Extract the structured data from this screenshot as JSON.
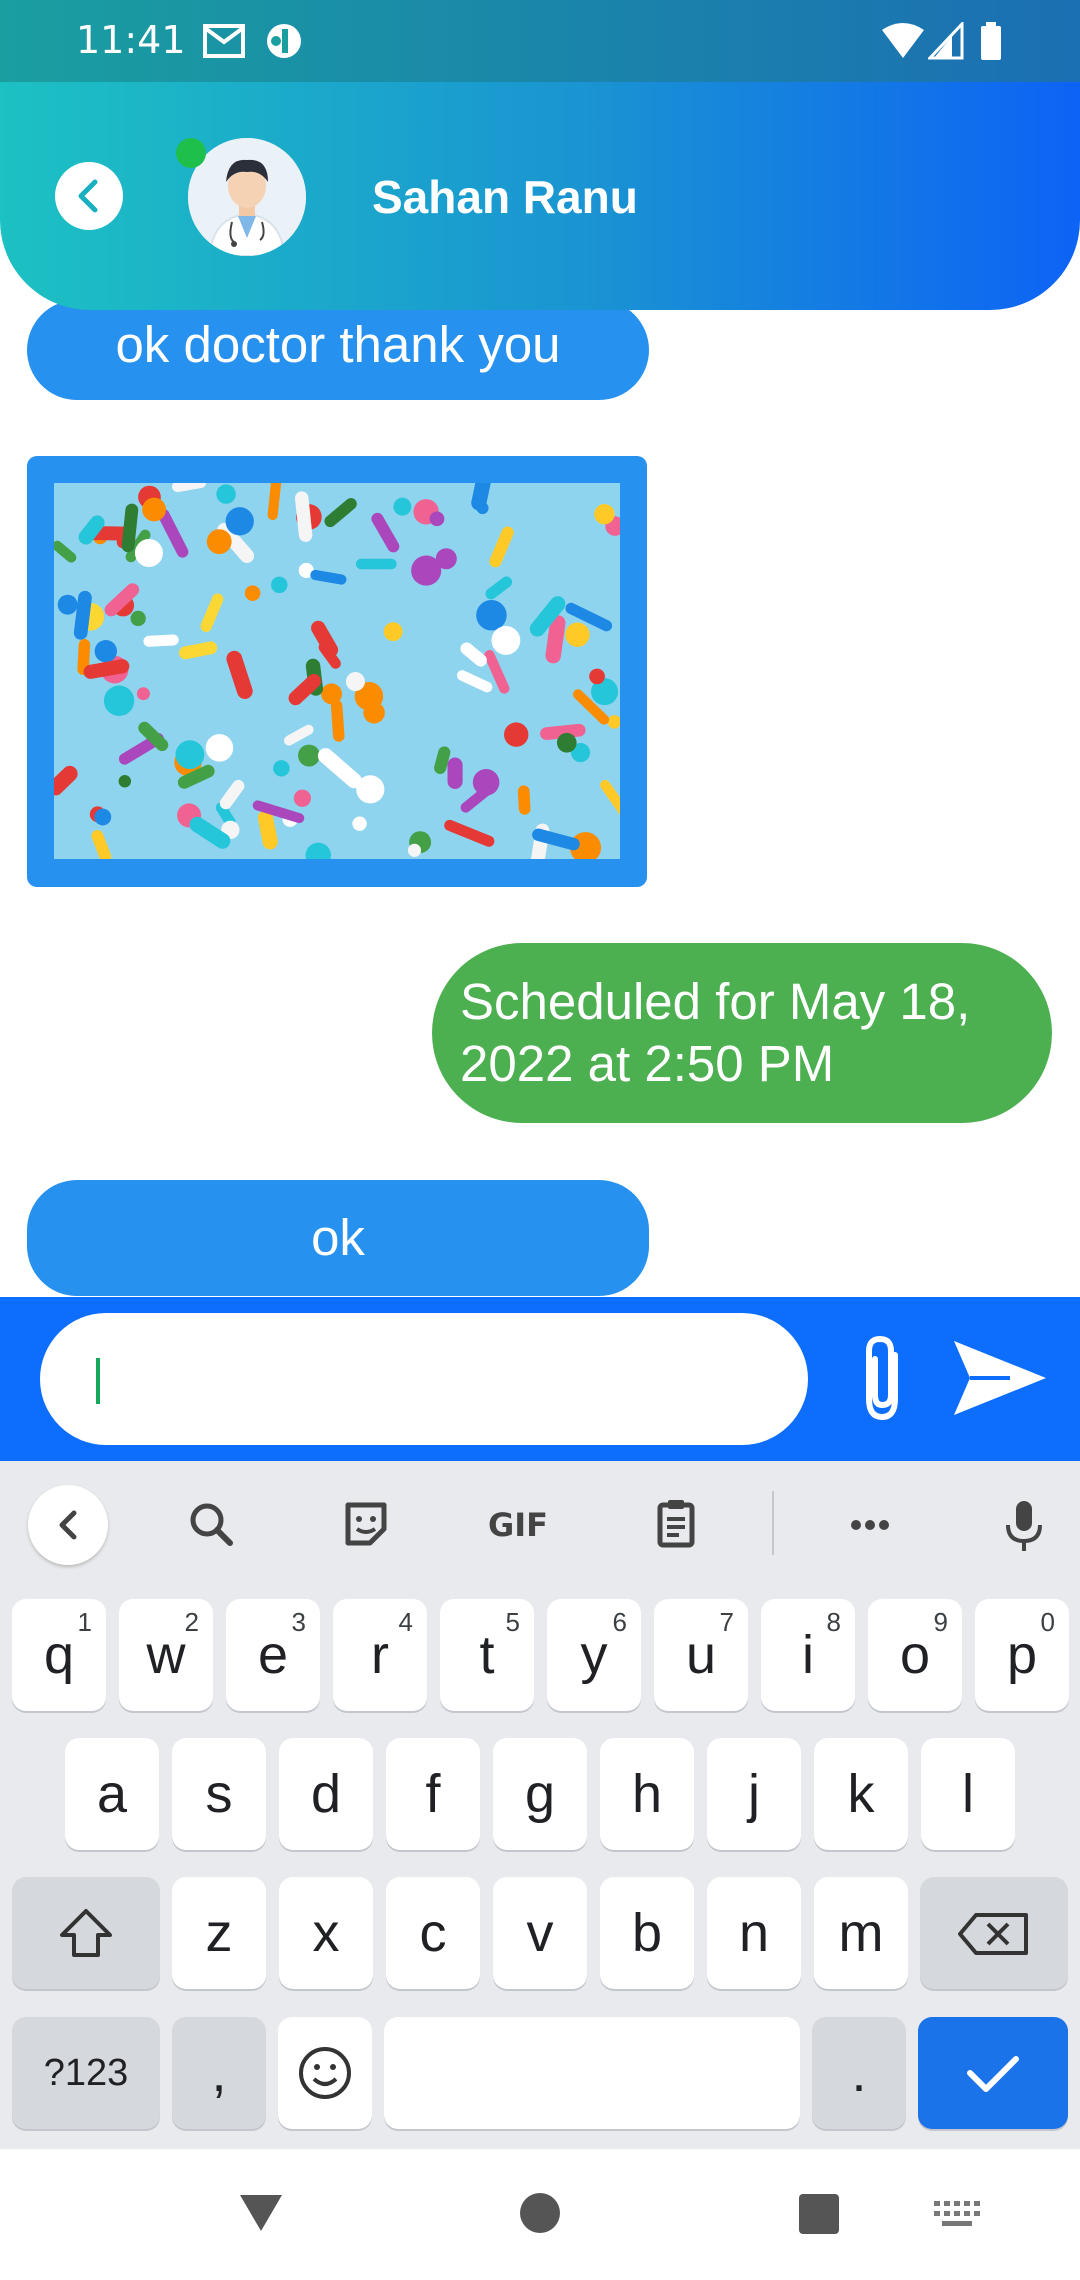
{
  "status_bar": {
    "time": "11:41"
  },
  "header": {
    "contact_name": "Sahan Ranu"
  },
  "messages": [
    {
      "text": "ok doctor thank you",
      "side": "left"
    },
    {
      "image": "colorful-pills-photo",
      "side": "left"
    },
    {
      "text": "Scheduled for May 18, 2022 at 2:50 PM",
      "side": "right"
    },
    {
      "text": "ok",
      "side": "left"
    }
  ],
  "compose": {
    "value": ""
  },
  "keyboard": {
    "row1": [
      {
        "key": "q",
        "hint": "1"
      },
      {
        "key": "w",
        "hint": "2"
      },
      {
        "key": "e",
        "hint": "3"
      },
      {
        "key": "r",
        "hint": "4"
      },
      {
        "key": "t",
        "hint": "5"
      },
      {
        "key": "y",
        "hint": "6"
      },
      {
        "key": "u",
        "hint": "7"
      },
      {
        "key": "i",
        "hint": "8"
      },
      {
        "key": "o",
        "hint": "9"
      },
      {
        "key": "p",
        "hint": "0"
      }
    ],
    "row2": [
      "a",
      "s",
      "d",
      "f",
      "g",
      "h",
      "j",
      "k",
      "l"
    ],
    "row3": [
      "z",
      "x",
      "c",
      "v",
      "b",
      "n",
      "m"
    ],
    "symbols_label": "?123",
    "comma": ",",
    "period": ".",
    "gif_label": "GIF"
  },
  "colors": {
    "header_start": "#1cc1c3",
    "header_end": "#0d63f5",
    "incoming_bubble": "#2691ee",
    "outgoing_bubble": "#4caf50",
    "compose_bar": "#0d6efd",
    "online_dot": "#1fbf4c"
  }
}
